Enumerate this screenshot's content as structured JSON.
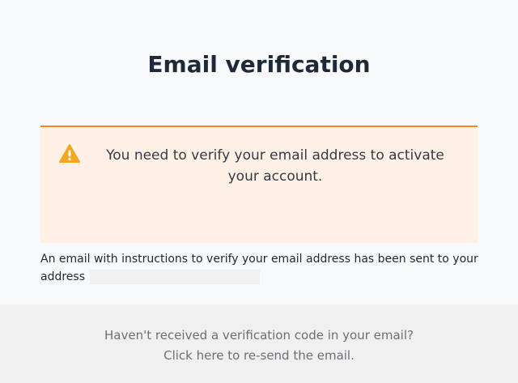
{
  "header": {
    "title": "Email verification"
  },
  "alert": {
    "icon": "warning-icon",
    "color": "#f08a24",
    "background": "#fff1e6",
    "message": "You need to verify your email address to activate your account."
  },
  "info": {
    "message": "An email with instructions to verify your email address has been sent to your address"
  },
  "footer": {
    "question": "Haven't received a verification code in your email?",
    "resend_link": "Click here to re-send the email."
  }
}
